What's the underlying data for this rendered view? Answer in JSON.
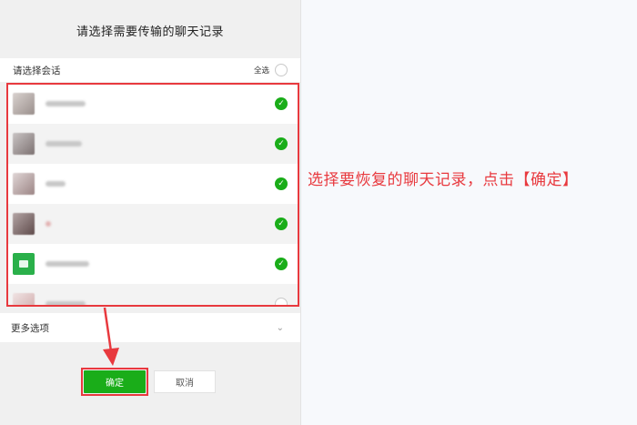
{
  "dialog": {
    "title": "请选择需要传输的聊天记录",
    "section_label": "请选择会话",
    "select_all_label": "全选"
  },
  "chats": [
    {
      "avatar_icon": "avatar-photo",
      "selected": true
    },
    {
      "avatar_icon": "avatar-photo",
      "selected": true
    },
    {
      "avatar_icon": "avatar-photo",
      "selected": true
    },
    {
      "avatar_icon": "avatar-photo",
      "selected": true
    },
    {
      "avatar_icon": "avatar-green-app",
      "selected": true
    },
    {
      "avatar_icon": "avatar-photo",
      "selected": false
    }
  ],
  "more_options": {
    "label": "更多选项"
  },
  "buttons": {
    "ok_label": "确定",
    "cancel_label": "取消"
  },
  "annotation": {
    "text": "选择要恢复的聊天记录，点击【确定】",
    "color": "#e8393e"
  },
  "colors": {
    "accent_green": "#1aad19",
    "highlight_red": "#e8393e"
  }
}
